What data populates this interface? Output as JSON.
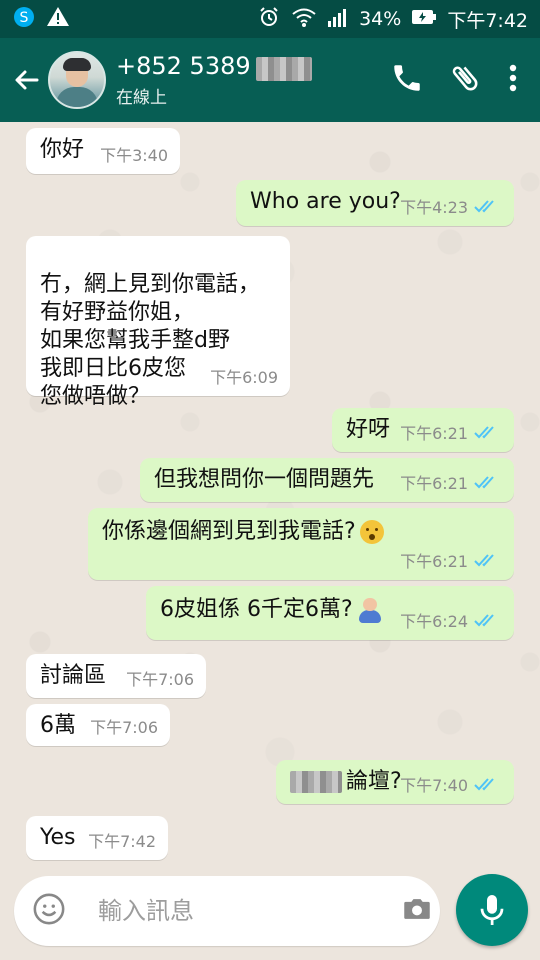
{
  "status_bar": {
    "battery": "34%",
    "time": "下午7:42"
  },
  "header": {
    "contact": "+852 5389",
    "presence": "在線上"
  },
  "messages": [
    {
      "text": "你好",
      "time": "下午3:40"
    },
    {
      "text": "Who are you?",
      "time": "下午4:23"
    },
    {
      "text": "冇，網上見到你電話，\n有好野益你姐，\n如果您幫我手整d野\n我即日比6皮您\n您做唔做？",
      "time": "下午6:09"
    },
    {
      "text": "好呀",
      "time": "下午6:21"
    },
    {
      "text": "但我想問你一個問題先",
      "time": "下午6:21"
    },
    {
      "text": "你係邊個網到見到我電話?",
      "time": "下午6:21"
    },
    {
      "text": "6皮姐係 6千定6萬?",
      "time": "下午6:24"
    },
    {
      "text": "討論區",
      "time": "下午7:06"
    },
    {
      "text": "6萬",
      "time": "下午7:06"
    },
    {
      "text": "論壇?",
      "time": "下午7:40"
    },
    {
      "text": "Yes",
      "time": "下午7:42"
    }
  ],
  "composer": {
    "placeholder": "輸入訊息"
  },
  "colors": {
    "appbar": "#075e54",
    "outgoing_bubble": "#dcf8c6",
    "incoming_bubble": "#ffffff",
    "tick_blue": "#4fc3f7",
    "mic_button": "#00897b"
  },
  "icons": [
    "back-arrow-icon",
    "phone-icon",
    "attach-icon",
    "more-vert-icon",
    "emoji-icon",
    "camera-icon",
    "mic-icon"
  ]
}
